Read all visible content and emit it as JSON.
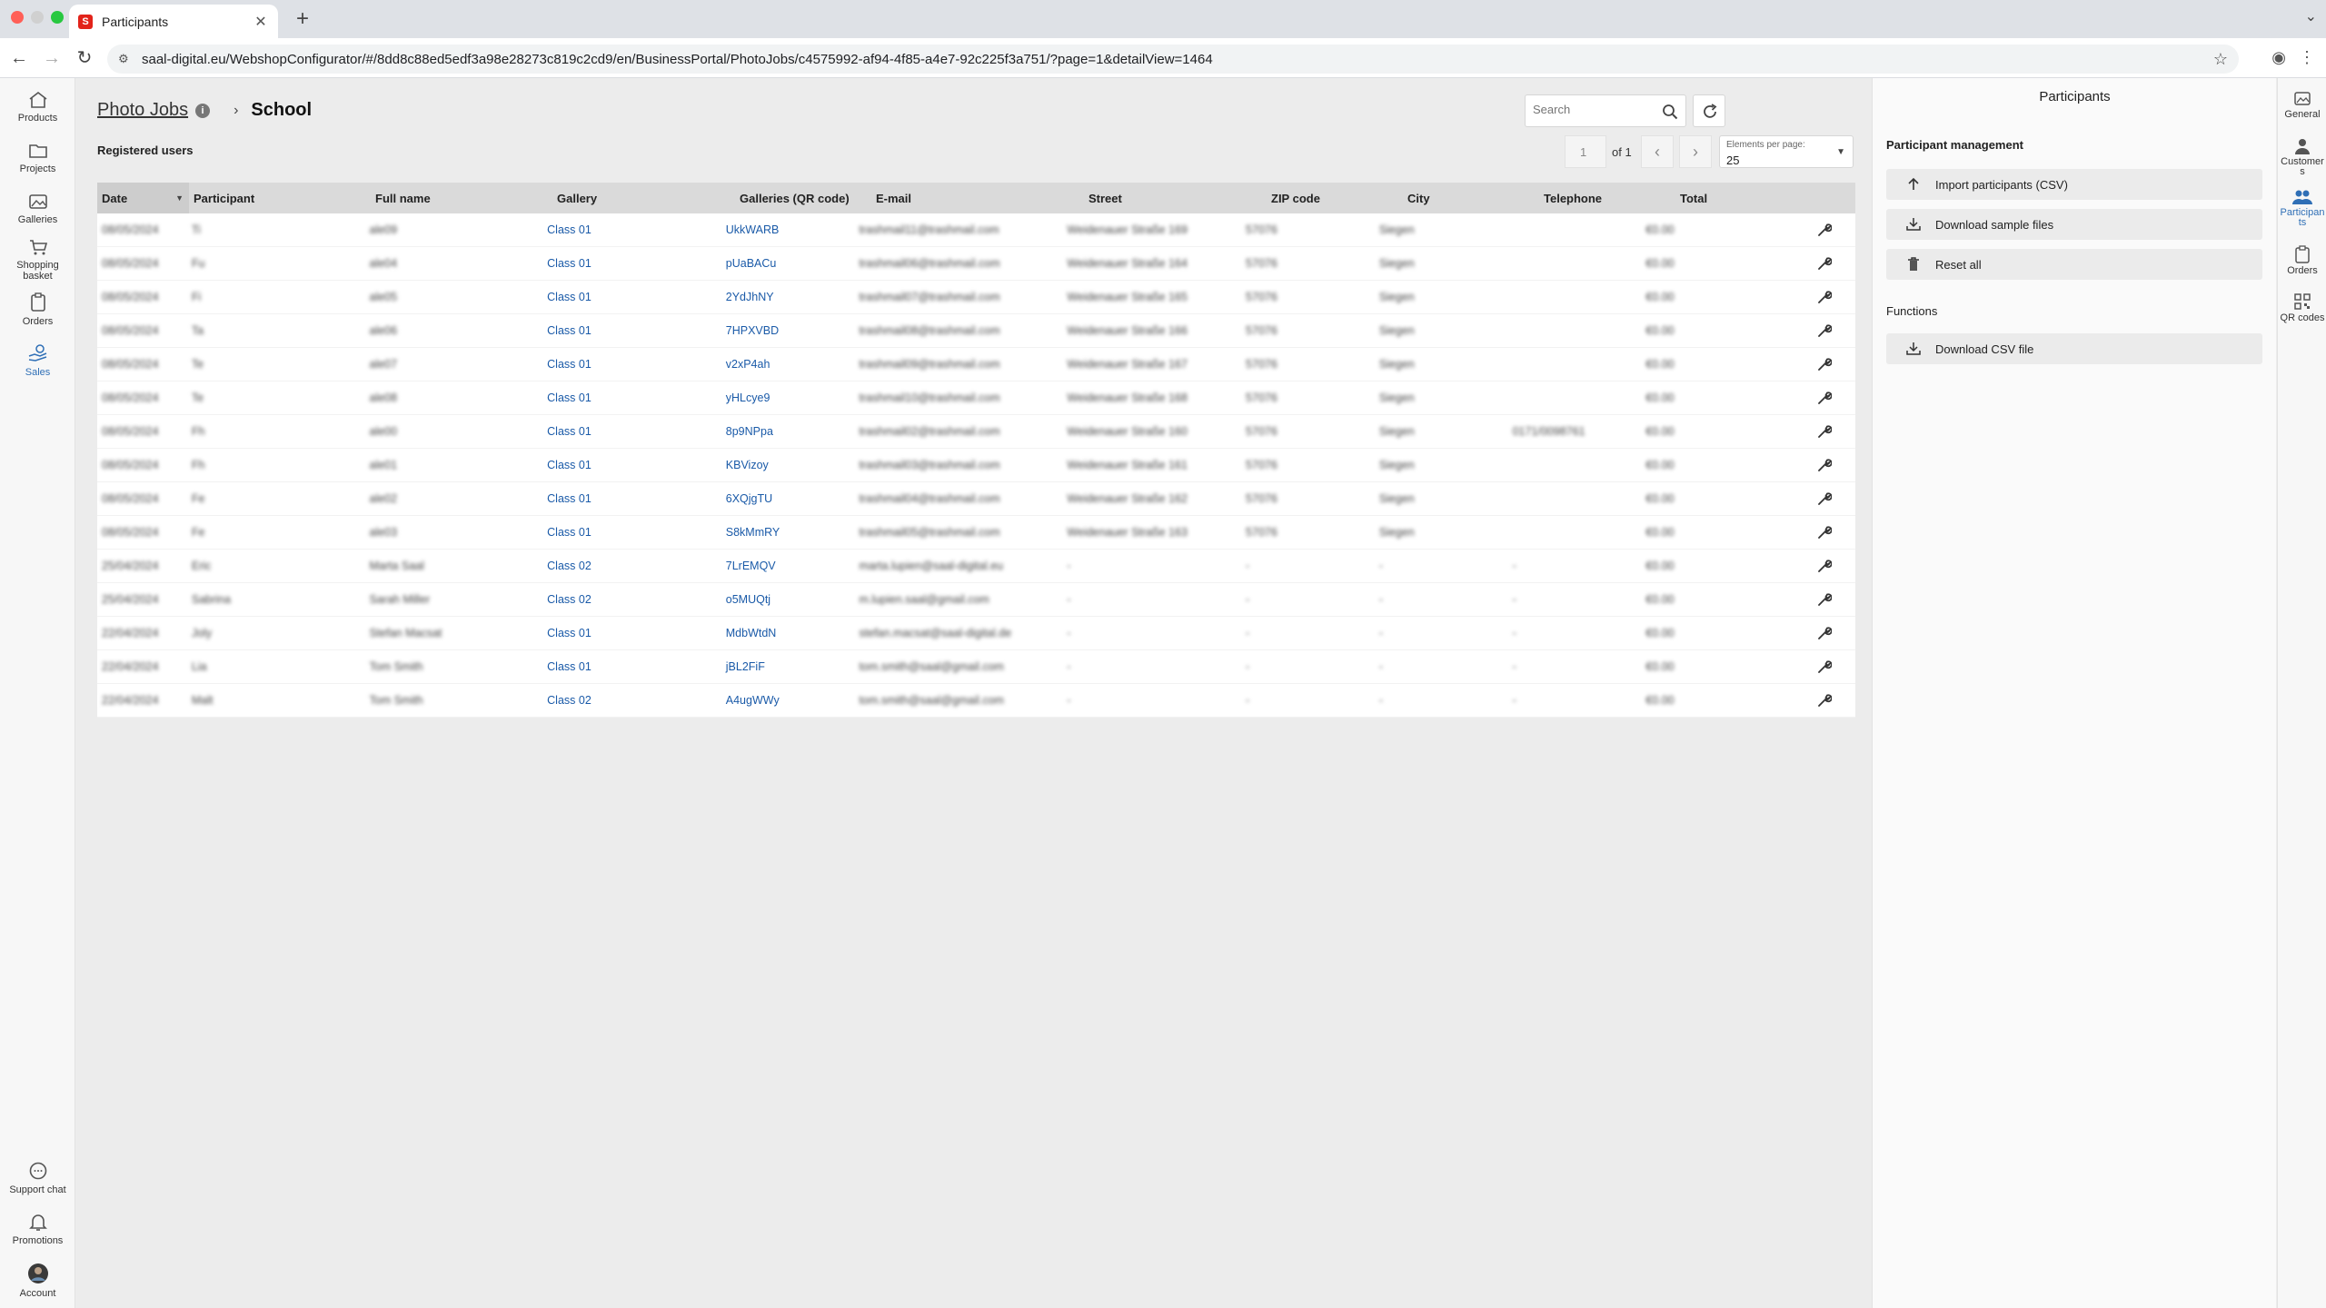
{
  "browser": {
    "tab_title": "Participants",
    "favicon_letter": "S",
    "url": "saal-digital.eu/WebshopConfigurator/#/8dd8c88ed5edf3a98e28273c819c2cd9/en/BusinessPortal/PhotoJobs/c4575992-af94-4f85-a4e7-92c225f3a751/?page=1&detailView=1464"
  },
  "left_nav": {
    "items": [
      {
        "label": "Products",
        "icon": "home-icon"
      },
      {
        "label": "Projects",
        "icon": "folder-icon"
      },
      {
        "label": "Galleries",
        "icon": "image-icon"
      },
      {
        "label": "Shopping basket",
        "icon": "cart-icon"
      },
      {
        "label": "Orders",
        "icon": "clipboard-icon"
      },
      {
        "label": "Sales",
        "icon": "sales-icon"
      }
    ],
    "bottom_items": [
      {
        "label": "Support chat",
        "icon": "chat-icon"
      },
      {
        "label": "Promotions",
        "icon": "bell-icon"
      },
      {
        "label": "Account",
        "icon": "avatar-icon"
      }
    ],
    "active": "Sales",
    "active_color": "#2f6fb6"
  },
  "main": {
    "breadcrumb_parent": "Photo Jobs",
    "info_glyph": "i",
    "breadcrumb_current": "School",
    "subheading": "Registered users",
    "search_placeholder": "Search",
    "pagination": {
      "page": "1",
      "of_label": "of 1",
      "elements_per_page_label": "Elements per page:",
      "elements_per_page_value": "25"
    },
    "table": {
      "columns": [
        "Date",
        "Participant",
        "Full name",
        "Gallery",
        "Galleries (QR code)",
        "E-mail",
        "Street",
        "ZIP code",
        "City",
        "Telephone",
        "Total"
      ],
      "rows": [
        {
          "date": "08/05/2024",
          "participant": "Ti",
          "full_name": "ale09",
          "gallery": "Class 01",
          "qr": "UkkWARB",
          "email": "trashmail11@trashmail.com",
          "street": "Weidenauer Straße 169",
          "zip": "57076",
          "city": "Siegen",
          "phone": "",
          "total": "€0.00"
        },
        {
          "date": "08/05/2024",
          "participant": "Fu",
          "full_name": "ale04",
          "gallery": "Class 01",
          "qr": "pUaBACu",
          "email": "trashmail06@trashmail.com",
          "street": "Weidenauer Straße 164",
          "zip": "57076",
          "city": "Siegen",
          "phone": "",
          "total": "€0.00"
        },
        {
          "date": "08/05/2024",
          "participant": "Fi",
          "full_name": "ale05",
          "gallery": "Class 01",
          "qr": "2YdJhNY",
          "email": "trashmail07@trashmail.com",
          "street": "Weidenauer Straße 165",
          "zip": "57076",
          "city": "Siegen",
          "phone": "",
          "total": "€0.00"
        },
        {
          "date": "08/05/2024",
          "participant": "Ta",
          "full_name": "ale06",
          "gallery": "Class 01",
          "qr": "7HPXVBD",
          "email": "trashmail08@trashmail.com",
          "street": "Weidenauer Straße 166",
          "zip": "57076",
          "city": "Siegen",
          "phone": "",
          "total": "€0.00"
        },
        {
          "date": "08/05/2024",
          "participant": "Te",
          "full_name": "ale07",
          "gallery": "Class 01",
          "qr": "v2xP4ah",
          "email": "trashmail09@trashmail.com",
          "street": "Weidenauer Straße 167",
          "zip": "57076",
          "city": "Siegen",
          "phone": "",
          "total": "€0.00"
        },
        {
          "date": "08/05/2024",
          "participant": "Te",
          "full_name": "ale08",
          "gallery": "Class 01",
          "qr": "yHLcye9",
          "email": "trashmail10@trashmail.com",
          "street": "Weidenauer Straße 168",
          "zip": "57076",
          "city": "Siegen",
          "phone": "",
          "total": "€0.00"
        },
        {
          "date": "08/05/2024",
          "participant": "Fh",
          "full_name": "ale00",
          "gallery": "Class 01",
          "qr": "8p9NPpa",
          "email": "trashmail02@trashmail.com",
          "street": "Weidenauer Straße 160",
          "zip": "57076",
          "city": "Siegen",
          "phone": "0171/0098761",
          "total": "€0.00"
        },
        {
          "date": "08/05/2024",
          "participant": "Fh",
          "full_name": "ale01",
          "gallery": "Class 01",
          "qr": "KBVizoy",
          "email": "trashmail03@trashmail.com",
          "street": "Weidenauer Straße 161",
          "zip": "57076",
          "city": "Siegen",
          "phone": "",
          "total": "€0.00"
        },
        {
          "date": "08/05/2024",
          "participant": "Fe",
          "full_name": "ale02",
          "gallery": "Class 01",
          "qr": "6XQjgTU",
          "email": "trashmail04@trashmail.com",
          "street": "Weidenauer Straße 162",
          "zip": "57076",
          "city": "Siegen",
          "phone": "",
          "total": "€0.00"
        },
        {
          "date": "08/05/2024",
          "participant": "Fe",
          "full_name": "ale03",
          "gallery": "Class 01",
          "qr": "S8kMmRY",
          "email": "trashmail05@trashmail.com",
          "street": "Weidenauer Straße 163",
          "zip": "57076",
          "city": "Siegen",
          "phone": "",
          "total": "€0.00"
        },
        {
          "date": "25/04/2024",
          "participant": "Eric",
          "full_name": "Marta Saal",
          "gallery": "Class 02",
          "qr": "7LrEMQV",
          "email": "marta.lupien@saal-digital.eu",
          "street": "-",
          "zip": "-",
          "city": "-",
          "phone": "-",
          "total": "€0.00"
        },
        {
          "date": "25/04/2024",
          "participant": "Sabrina",
          "full_name": "Sarah Miller",
          "gallery": "Class 02",
          "qr": "o5MUQtj",
          "email": "m.lupien.saal@gmail.com",
          "street": "-",
          "zip": "-",
          "city": "-",
          "phone": "-",
          "total": "€0.00"
        },
        {
          "date": "22/04/2024",
          "participant": "Joly",
          "full_name": "Stefan Macsat",
          "gallery": "Class 01",
          "qr": "MdbWtdN",
          "email": "stefan.macsat@saal-digital.de",
          "street": "-",
          "zip": "-",
          "city": "-",
          "phone": "-",
          "total": "€0.00"
        },
        {
          "date": "22/04/2024",
          "participant": "Lia",
          "full_name": "Tom Smith",
          "gallery": "Class 01",
          "qr": "jBL2FiF",
          "email": "tom.smith@saal@gmail.com",
          "street": "-",
          "zip": "-",
          "city": "-",
          "phone": "-",
          "total": "€0.00"
        },
        {
          "date": "22/04/2024",
          "participant": "Malt",
          "full_name": "Tom Smith",
          "gallery": "Class 02",
          "qr": "A4ugWWy",
          "email": "tom.smith@saal@gmail.com",
          "street": "-",
          "zip": "-",
          "city": "-",
          "phone": "-",
          "total": "€0.00"
        }
      ]
    }
  },
  "right_panel": {
    "title": "Participants",
    "participant_management_label": "Participant management",
    "import_label": "Import participants (CSV)",
    "download_samples_label": "Download sample files",
    "reset_label": "Reset all",
    "functions_label": "Functions",
    "download_csv_label": "Download CSV file"
  },
  "right_nav": {
    "items": [
      {
        "label": "General",
        "icon": "image-icon"
      },
      {
        "label": "Customers",
        "icon": "person-icon"
      },
      {
        "label": "Participants",
        "icon": "people-icon"
      },
      {
        "label": "Orders",
        "icon": "clipboard-icon"
      },
      {
        "label": "QR codes",
        "icon": "qr-icon"
      }
    ],
    "active": "Participants"
  },
  "colors": {
    "link": "#1a5aa8",
    "accent": "#2f6fb6",
    "brand_red": "#e2231a",
    "header_bg": "#dadada"
  }
}
